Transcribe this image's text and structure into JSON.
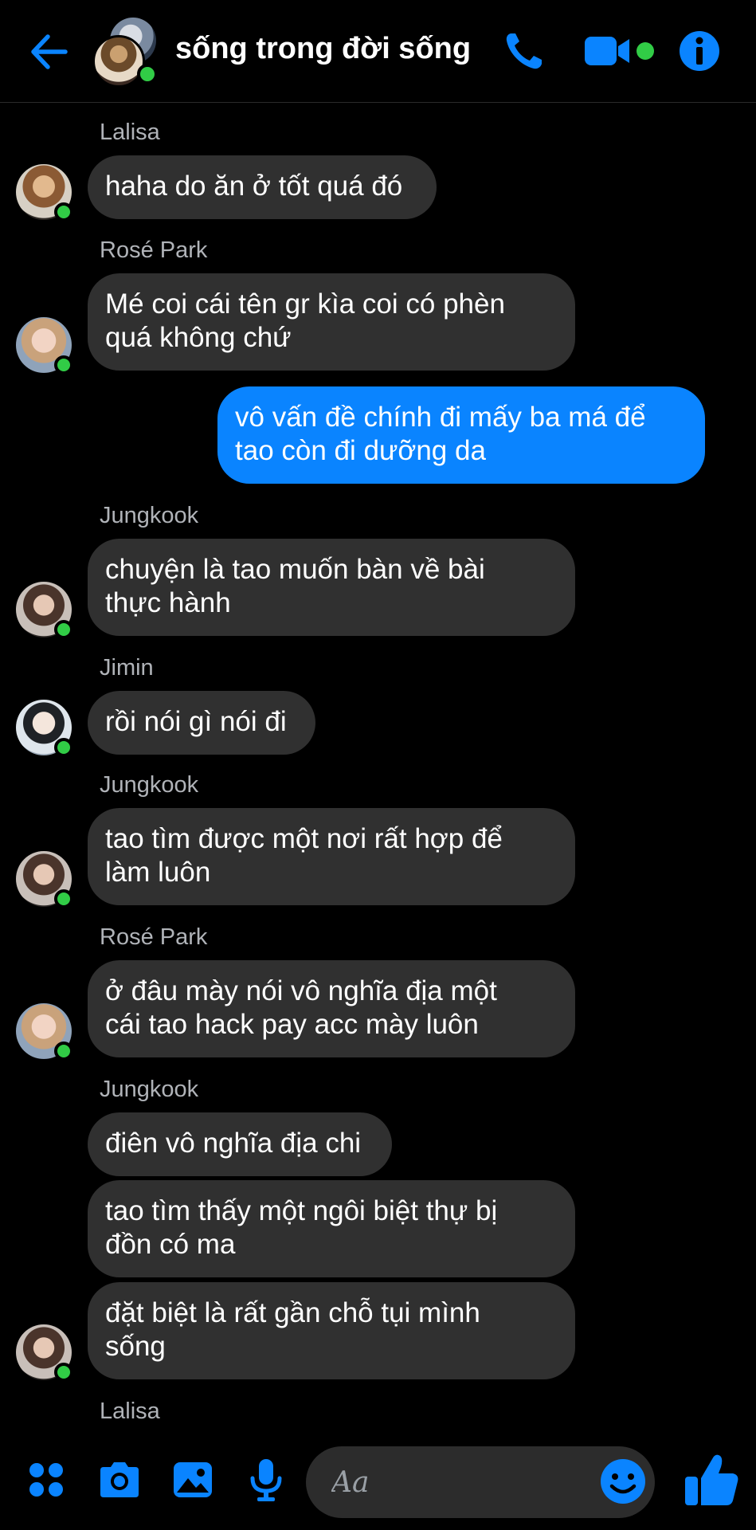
{
  "header": {
    "title": "sống trong đời sống",
    "back_icon": "arrow-left-icon",
    "call_icon": "phone-icon",
    "video_icon": "video-camera-icon",
    "info_icon": "info-icon",
    "accent": "#0a84ff",
    "online": "#31cc46"
  },
  "messages": [
    {
      "sender": "Lalisa",
      "text": "haha do ăn ở tốt quá đó"
    },
    {
      "sender": "Rosé Park",
      "lines": [
        "Mé coi cái tên gr kìa coi có phèn",
        "quá không chứ"
      ]
    },
    {
      "sender": "me",
      "lines": [
        "vô vấn đề chính đi mấy ba má để",
        "tao còn đi dưỡng da"
      ]
    },
    {
      "sender": "Jungkook",
      "lines": [
        "chuyện là tao muốn bàn về bài",
        "thực hành"
      ]
    },
    {
      "sender": "Jimin",
      "text": "rồi nói gì nói đi"
    },
    {
      "sender": "Jungkook",
      "lines": [
        "tao tìm được một nơi rất hợp để",
        "làm luôn"
      ]
    },
    {
      "sender": "Rosé Park",
      "lines": [
        "ở đâu mày nói vô nghĩa địa một",
        "cái tao hack pay acc mày luôn"
      ]
    },
    {
      "sender": "Jungkook",
      "text": "điên vô nghĩa địa chi"
    },
    {
      "sender": "Jungkook",
      "lines": [
        "tao tìm thấy một ngôi biệt thự bị",
        "đồn có ma"
      ]
    },
    {
      "sender": "Jungkook",
      "lines": [
        "đặt biệt là rất gần chỗ tụi mình",
        "sống"
      ]
    },
    {
      "sender": "Lalisa"
    }
  ],
  "composer": {
    "placeholder": "Aa",
    "icons": [
      "apps-icon",
      "camera-icon",
      "image-icon",
      "microphone-icon",
      "emoji-icon",
      "thumbs-up-icon"
    ]
  }
}
